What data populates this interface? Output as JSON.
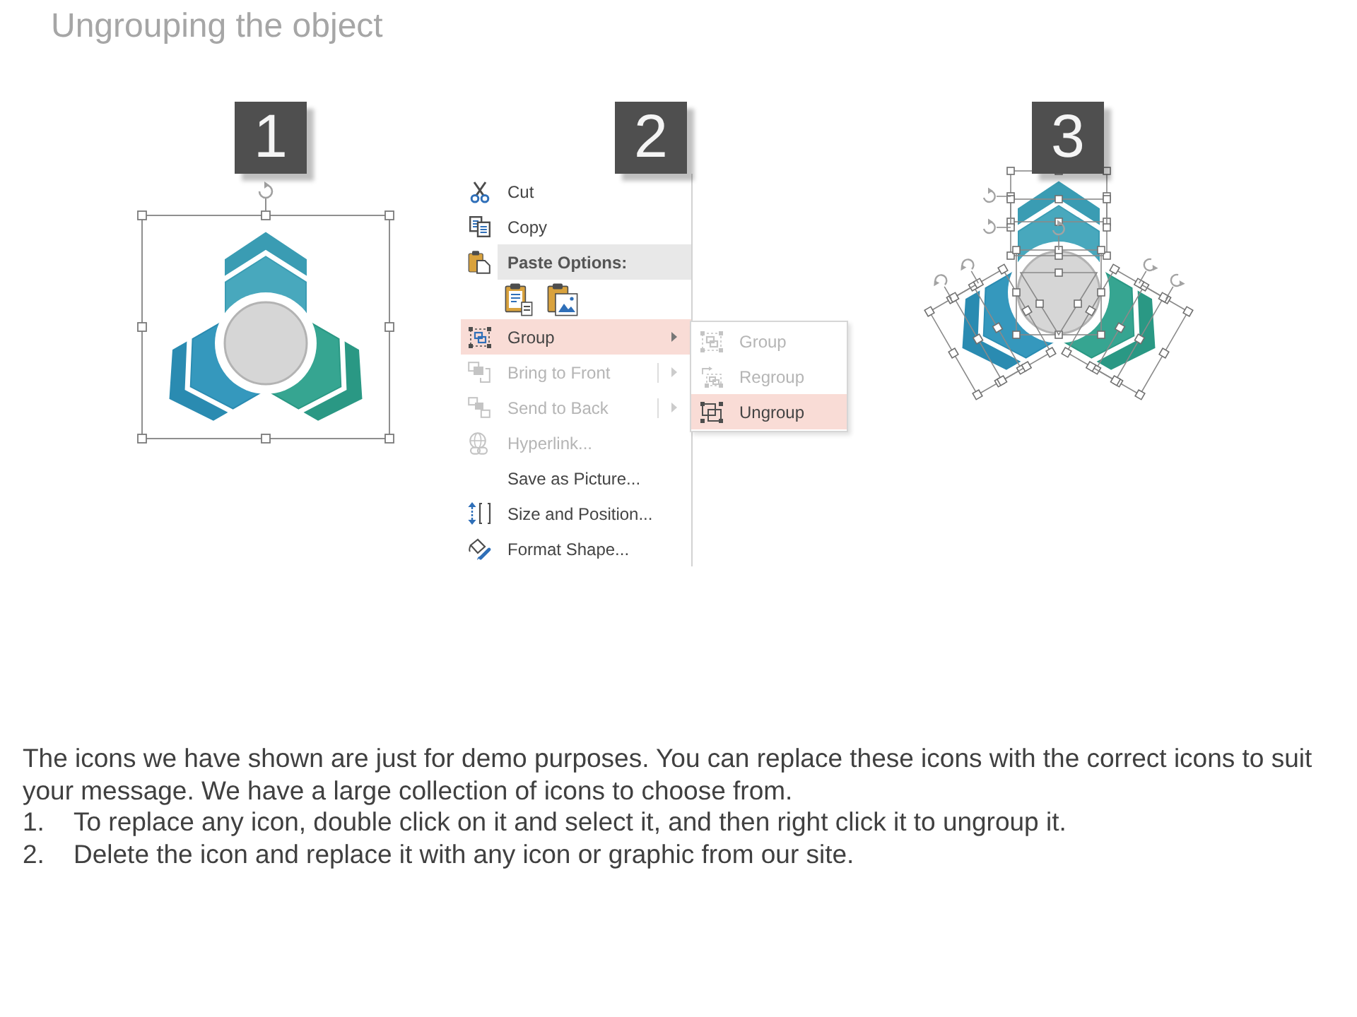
{
  "slide": {
    "title": "Ungrouping the object"
  },
  "steps": [
    {
      "number": "1",
      "kind": "selected_group"
    },
    {
      "number": "2",
      "kind": "context_menu",
      "menu": {
        "items": [
          {
            "kind": "command",
            "label": "Cut",
            "disabled": false,
            "selected": false
          },
          {
            "kind": "command",
            "label": "Copy",
            "disabled": false,
            "selected": false
          },
          {
            "kind": "header",
            "label": "Paste Options:"
          },
          {
            "kind": "paste_options"
          },
          {
            "kind": "submenu",
            "label": "Group",
            "disabled": false,
            "selected": true
          },
          {
            "kind": "split_submenu",
            "label": "Bring to Front",
            "disabled": true,
            "selected": false
          },
          {
            "kind": "split_submenu",
            "label": "Send to Back",
            "disabled": true,
            "selected": false
          },
          {
            "kind": "command",
            "label": "Hyperlink...",
            "disabled": true,
            "selected": false
          },
          {
            "kind": "command",
            "label": "Save as Picture...",
            "disabled": false,
            "selected": false
          },
          {
            "kind": "command",
            "label": "Size and Position...",
            "disabled": false,
            "selected": false
          },
          {
            "kind": "command",
            "label": "Format Shape...",
            "disabled": false,
            "selected": false
          }
        ],
        "submenu": {
          "items": [
            {
              "label": "Group",
              "disabled": true,
              "selected": false
            },
            {
              "label": "Regroup",
              "disabled": true,
              "selected": false
            },
            {
              "label": "Ungroup",
              "disabled": false,
              "selected": true
            }
          ]
        }
      }
    },
    {
      "number": "3",
      "kind": "ungrouped_shapes"
    }
  ],
  "description": {
    "paragraph": "The icons we have shown are just for demo purposes. You can replace these icons with the correct icons to suit your message. We have a large collection of icons to choose from.",
    "list": [
      {
        "marker": "1.",
        "text": "To replace any icon, double click on it and select it, and then right click it to ungroup it."
      },
      {
        "marker": "2.",
        "text": "Delete the icon and replace it with any icon or graphic from our site."
      }
    ]
  }
}
